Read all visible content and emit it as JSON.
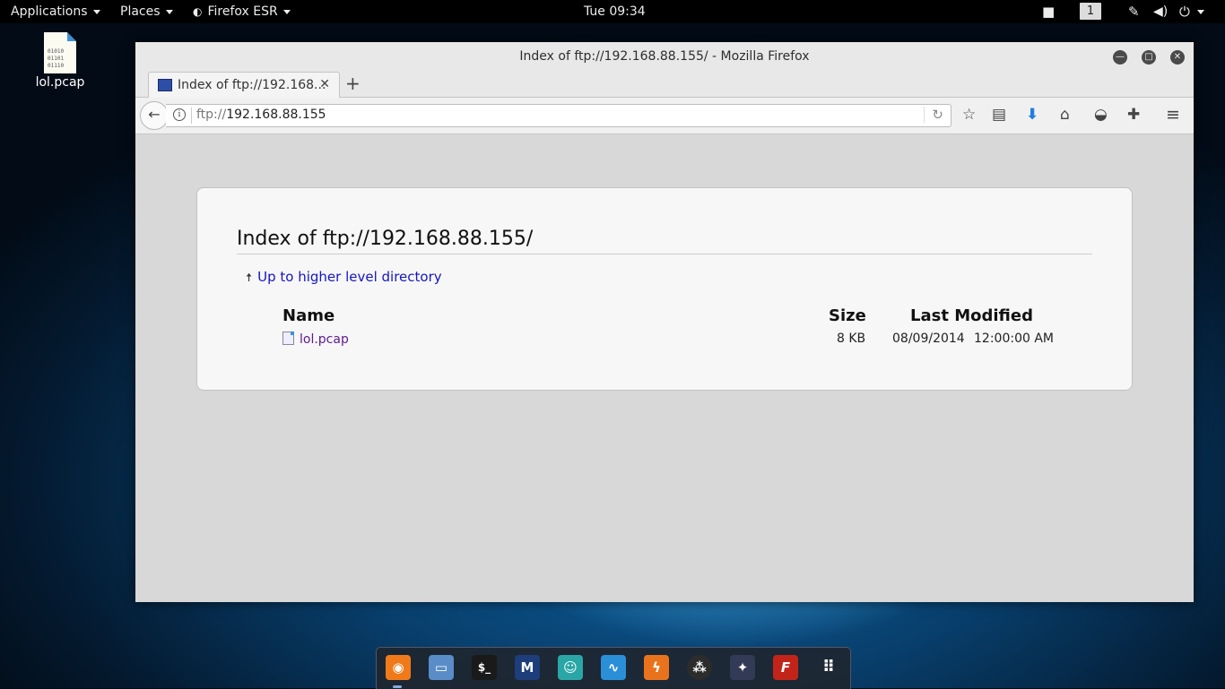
{
  "topbar": {
    "applications": "Applications",
    "places": "Places",
    "firefox_menu": "Firefox ESR",
    "clock": "Tue 09:34",
    "workspace": "1"
  },
  "desktop": {
    "file_label": "lol.pcap",
    "file_glyph": [
      "01010",
      "01101",
      "01110"
    ]
  },
  "window": {
    "title": "Index of ftp://192.168.88.155/ - Mozilla Firefox",
    "tab_label": "Index of ftp://192.168...",
    "url_scheme": "ftp://",
    "url_host": "192.168.88.155"
  },
  "page": {
    "heading": "Index of ftp://192.168.88.155/",
    "up_link": "Up to higher level directory",
    "columns": {
      "name": "Name",
      "size": "Size",
      "modified": "Last Modified"
    },
    "files": [
      {
        "name": "lol.pcap",
        "size": "8 KB",
        "date": "08/09/2014",
        "time": "12:00:00 AM"
      }
    ]
  },
  "dock": {
    "items": [
      "firefox-icon",
      "files-icon",
      "terminal-icon",
      "metasploit-icon",
      "armitage-icon",
      "burpsuite-icon",
      "wireshark-icon",
      "maltego-icon",
      "beef-icon",
      "faraday-icon",
      "show-apps-icon"
    ]
  },
  "colors": {
    "link": "#1515c5",
    "visited": "#5f1a8c",
    "download_arrow": "#1f7fe0"
  }
}
